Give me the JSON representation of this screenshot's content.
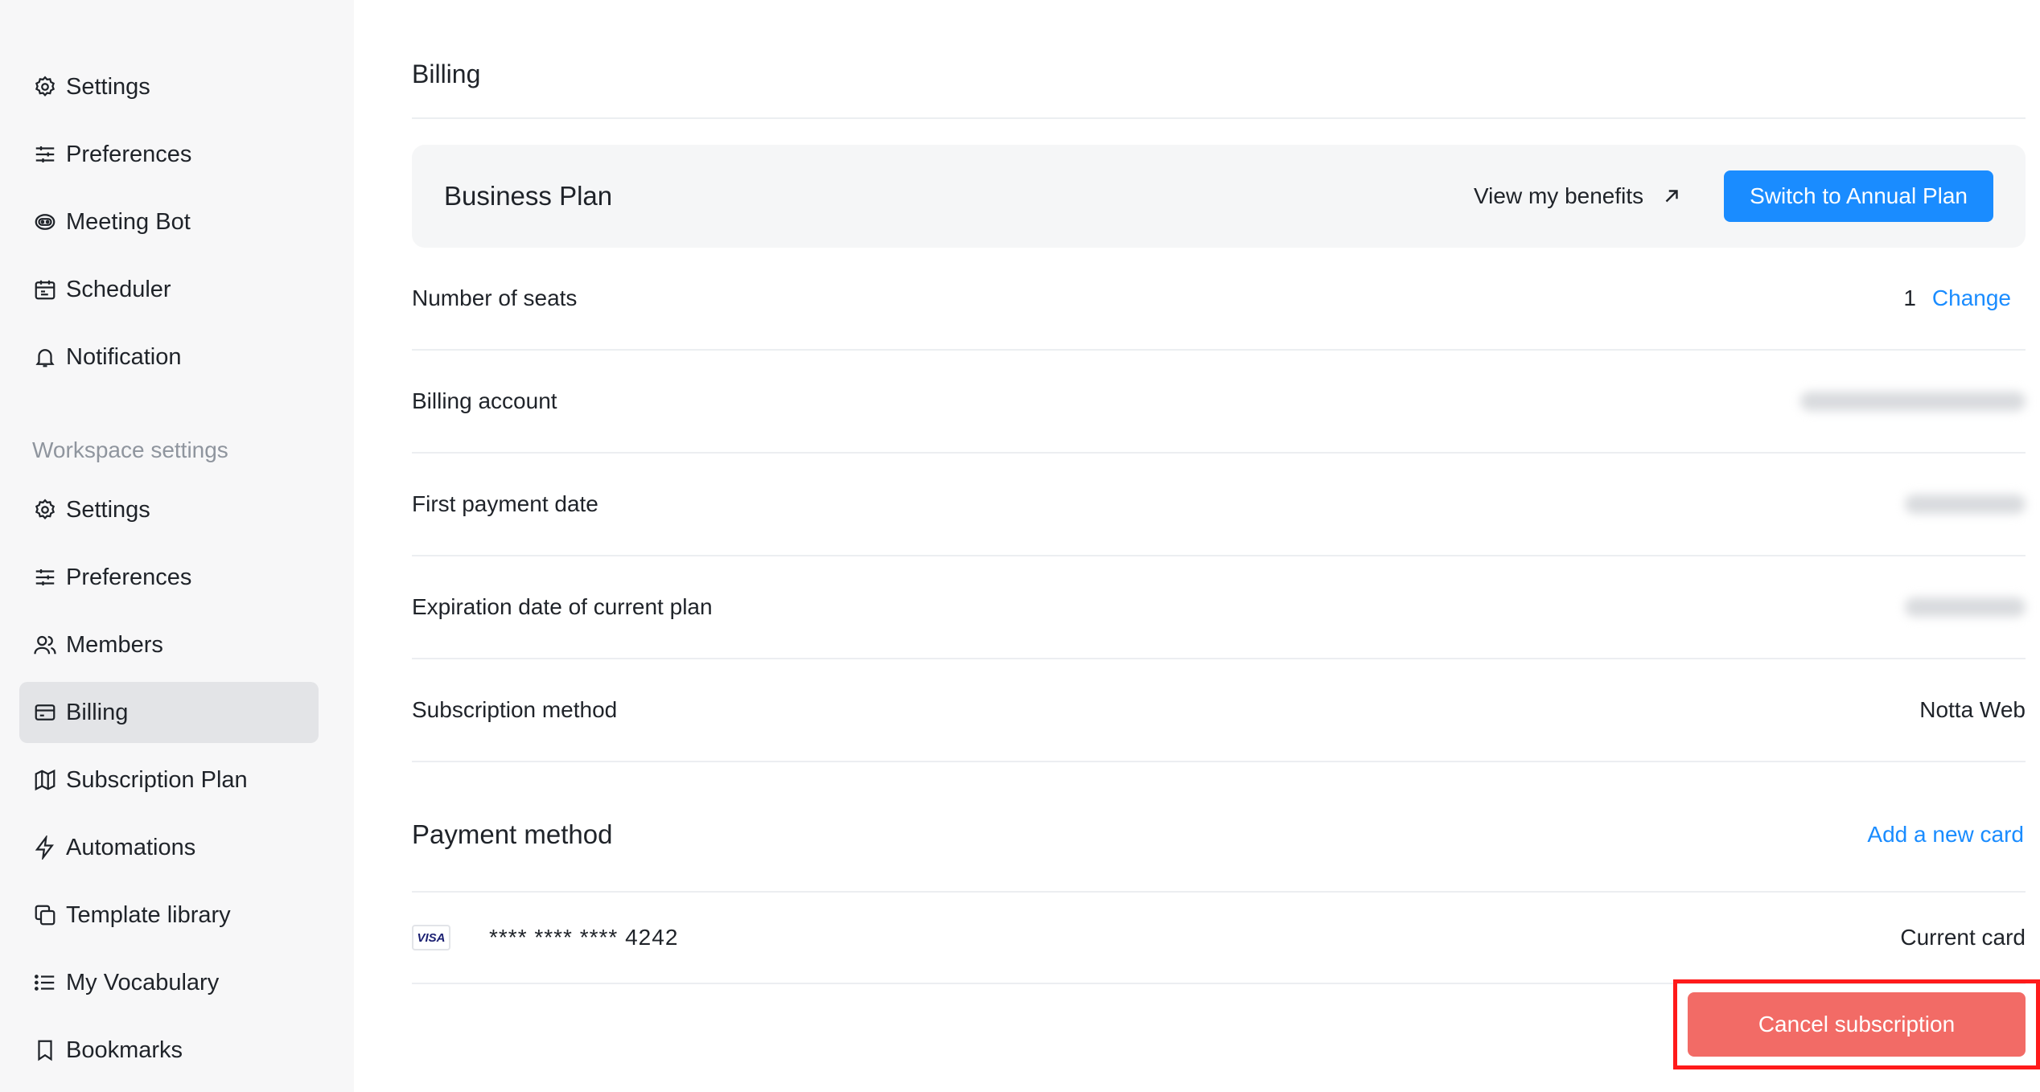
{
  "sidebar": {
    "personal_items": [
      {
        "label": "Settings",
        "icon": "gear-icon"
      },
      {
        "label": "Preferences",
        "icon": "sliders-icon"
      },
      {
        "label": "Meeting Bot",
        "icon": "bot-icon"
      },
      {
        "label": "Scheduler",
        "icon": "calendar-icon"
      },
      {
        "label": "Notification",
        "icon": "bell-icon"
      }
    ],
    "workspace_section_title": "Workspace settings",
    "workspace_items": [
      {
        "label": "Settings",
        "icon": "gear-icon"
      },
      {
        "label": "Preferences",
        "icon": "sliders-icon"
      },
      {
        "label": "Members",
        "icon": "users-icon"
      },
      {
        "label": "Billing",
        "icon": "credit-card-icon",
        "active": true
      },
      {
        "label": "Subscription Plan",
        "icon": "map-icon"
      },
      {
        "label": "Automations",
        "icon": "bolt-icon"
      },
      {
        "label": "Template library",
        "icon": "copy-icon"
      },
      {
        "label": "My Vocabulary",
        "icon": "list-icon"
      },
      {
        "label": "Bookmarks",
        "icon": "bookmark-icon"
      }
    ]
  },
  "billing": {
    "title": "Billing",
    "plan_name": "Business Plan",
    "benefits_label": "View my benefits",
    "switch_button": "Switch to Annual Plan",
    "rows": {
      "seats_label": "Number of seats",
      "seats_value": "1",
      "seats_change": "Change",
      "account_label": "Billing account",
      "first_payment_label": "First payment date",
      "expiration_label": "Expiration date of current plan",
      "subscription_method_label": "Subscription method",
      "subscription_method_value": "Notta Web"
    },
    "payment": {
      "title": "Payment method",
      "add_card": "Add a new card",
      "card_brand": "VISA",
      "card_number": "**** **** **** 4242",
      "card_status": "Current card"
    },
    "cancel_button": "Cancel subscription"
  },
  "colors": {
    "accent": "#1a8cff",
    "cancel": "#f26b66",
    "highlight_border": "#ff1a1a",
    "sidebar_bg": "#f7f7f8",
    "active_bg": "#e3e4e7"
  }
}
